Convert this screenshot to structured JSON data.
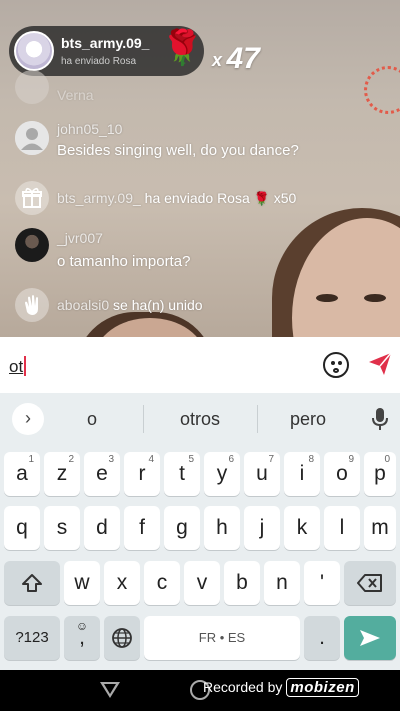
{
  "gift_banner": {
    "username": "bts_army.09_",
    "action": "ha enviado Rosa",
    "count_prefix": "x",
    "count": "47"
  },
  "chat": [
    {
      "name": "Verna",
      "message": ""
    },
    {
      "name": "john05_10",
      "message": "Besides singing well, do you dance?"
    },
    {
      "name": "bts_army.09_",
      "message": "ha enviado Rosa",
      "suffix": "x50"
    },
    {
      "name": "_jvr007",
      "message": "o tamanho importa?"
    },
    {
      "name": "aboalsi0",
      "message": "se ha(n) unido"
    }
  ],
  "input": {
    "value": "ot"
  },
  "keyboard": {
    "suggestions": [
      "o",
      "otros",
      "pero"
    ],
    "row1": [
      [
        "a",
        "1"
      ],
      [
        "z",
        "2"
      ],
      [
        "e",
        "3"
      ],
      [
        "r",
        "4"
      ],
      [
        "t",
        "5"
      ],
      [
        "y",
        "6"
      ],
      [
        "u",
        "7"
      ],
      [
        "i",
        "8"
      ],
      [
        "o",
        "9"
      ],
      [
        "p",
        "0"
      ]
    ],
    "row2": [
      "q",
      "s",
      "d",
      "f",
      "g",
      "h",
      "j",
      "k",
      "l",
      "m"
    ],
    "row3": [
      "w",
      "x",
      "c",
      "v",
      "b",
      "n",
      "'"
    ],
    "symbols_label": "?123",
    "comma": ",",
    "space_label": "FR • ES",
    "period": "."
  },
  "recording": {
    "prefix": "Recorded by",
    "brand": "mobizen"
  },
  "colors": {
    "accent_red": "#e0304a",
    "enter_key": "#53ad9e",
    "keyboard_bg": "#e9eef0"
  }
}
